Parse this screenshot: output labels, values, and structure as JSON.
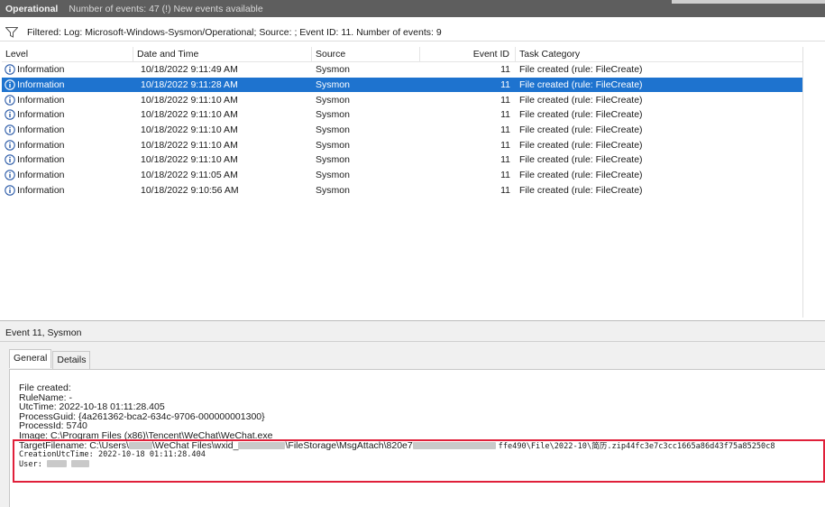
{
  "titlebar": {
    "name": "Operational",
    "status": "Number of events: 47 (!) New events available"
  },
  "filter": {
    "text": "Filtered: Log: Microsoft-Windows-Sysmon/Operational; Source: ; Event ID: 11. Number of events: 9"
  },
  "grid": {
    "columns": {
      "level": "Level",
      "date": "Date and Time",
      "source": "Source",
      "event_id": "Event ID",
      "category": "Task Category"
    },
    "selected_index": 1,
    "rows": [
      {
        "level": "Information",
        "date": "10/18/2022 9:11:49 AM",
        "source": "Sysmon",
        "event_id": "11",
        "category": "File created (rule: FileCreate)"
      },
      {
        "level": "Information",
        "date": "10/18/2022 9:11:28 AM",
        "source": "Sysmon",
        "event_id": "11",
        "category": "File created (rule: FileCreate)"
      },
      {
        "level": "Information",
        "date": "10/18/2022 9:11:10 AM",
        "source": "Sysmon",
        "event_id": "11",
        "category": "File created (rule: FileCreate)"
      },
      {
        "level": "Information",
        "date": "10/18/2022 9:11:10 AM",
        "source": "Sysmon",
        "event_id": "11",
        "category": "File created (rule: FileCreate)"
      },
      {
        "level": "Information",
        "date": "10/18/2022 9:11:10 AM",
        "source": "Sysmon",
        "event_id": "11",
        "category": "File created (rule: FileCreate)"
      },
      {
        "level": "Information",
        "date": "10/18/2022 9:11:10 AM",
        "source": "Sysmon",
        "event_id": "11",
        "category": "File created (rule: FileCreate)"
      },
      {
        "level": "Information",
        "date": "10/18/2022 9:11:10 AM",
        "source": "Sysmon",
        "event_id": "11",
        "category": "File created (rule: FileCreate)"
      },
      {
        "level": "Information",
        "date": "10/18/2022 9:11:05 AM",
        "source": "Sysmon",
        "event_id": "11",
        "category": "File created (rule: FileCreate)"
      },
      {
        "level": "Information",
        "date": "10/18/2022 9:10:56 AM",
        "source": "Sysmon",
        "event_id": "11",
        "category": "File created (rule: FileCreate)"
      }
    ]
  },
  "detail": {
    "title": "Event 11, Sysmon",
    "tabs": {
      "general": "General",
      "details": "Details"
    },
    "lines": {
      "file_created": "File created:",
      "rule_name": "RuleName: -",
      "utc_time": "UtcTime: 2022-10-18 01:11:28.405",
      "process_guid": "ProcessGuid: {4a261362-bca2-634c-9706-000000001300}",
      "process_id": "ProcessId: 5740",
      "image": "Image: C:\\Program Files (x86)\\Tencent\\WeChat\\WeChat.exe",
      "target_a": "TargetFilename: C:\\Users\\",
      "target_b": "\\WeChat Files\\wxid_",
      "target_c": "\\FileStorage\\MsgAttach\\820e7",
      "target_d": "ffe490\\File\\2022-10\\简历.zip44fc3e7c3cc1665a86d43f75a85250c8",
      "creation_utc": "CreationUtcTime: 2022-10-18 01:11:28.404",
      "user": "User:"
    }
  },
  "colors": {
    "titlebar": "#5e5e5e",
    "selection": "#1e73cf",
    "info_icon": "#2a5aa8",
    "highlight": "#e0203a"
  }
}
